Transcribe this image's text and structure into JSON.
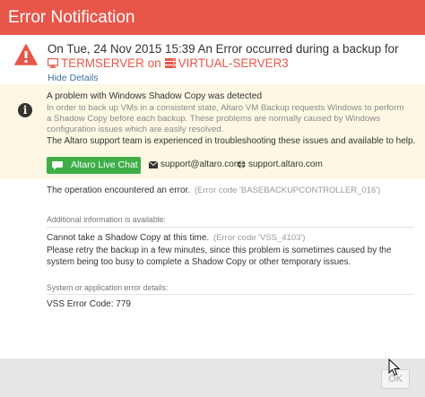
{
  "window": {
    "title": "Error Notification"
  },
  "error_header": {
    "message": "On Tue, 24 Nov 2015 15:39 An Error occurred during a backup for",
    "host": "TERMSERVER",
    "on_word": "on",
    "vm": "VIRTUAL-SERVER3",
    "hide_details": "Hide Details",
    "icons": [
      "warning-triangle-icon",
      "monitor-icon",
      "server-icon"
    ]
  },
  "info_panel": {
    "icon": "info-circle-icon",
    "title": "A problem with Windows Shadow Copy was detected",
    "description": "In order to back up VMs in a consistent state, Altaro VM Backup requests Windows to perform a Shadow Copy before each backup. These problems are normally caused by Windows configuration issues which are easily resolved.",
    "support_text": "The Altaro support team is experienced in troubleshooting these issues and available to help.",
    "live_chat_label": "Altaro Live Chat",
    "support_email": "support@altaro.com",
    "support_site": "support.altaro.com"
  },
  "details": {
    "operation_text": "The operation encountered an error.",
    "operation_code": "(Error code 'BASEBACKUPCONTROLLER_016')",
    "additional_label": "Additional information is available:",
    "shadow_text": "Cannot take a Shadow Copy at this time.",
    "shadow_code": "(Error code 'VSS_4103')",
    "retry_text": "Please retry the backup in a few minutes, since this problem is sometimes caused by the system being too busy to complete a Shadow Copy or other temporary issues.",
    "system_label": "System or application error details:",
    "vss_code": "VSS Error Code: 779"
  },
  "footer": {
    "ok_label": "OK"
  },
  "colors": {
    "title_bar": "#e8564a",
    "error_red": "#e8564a",
    "info_background": "#fcf8e3",
    "chat_green": "#3fae49",
    "link_blue": "#3a6f9b",
    "footer_gray": "#e7e7e7"
  }
}
